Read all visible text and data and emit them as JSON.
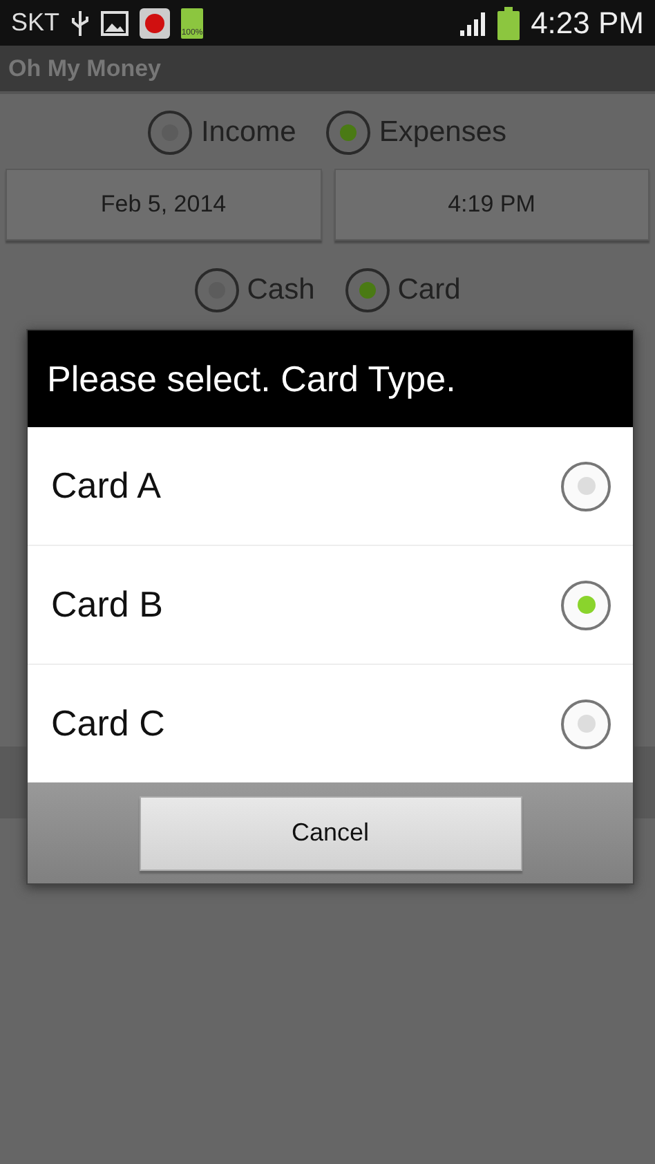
{
  "status_bar": {
    "carrier": "SKT",
    "battery_label": "100%",
    "time": "4:23 PM"
  },
  "app_bar": {
    "title": "Oh My Money"
  },
  "type_options": [
    {
      "label": "Income",
      "selected": false
    },
    {
      "label": "Expenses",
      "selected": true
    }
  ],
  "date_button": "Feb 5, 2014",
  "time_button": "4:19 PM",
  "payment_options": [
    {
      "label": "Cash",
      "selected": false
    },
    {
      "label": "Card",
      "selected": true
    }
  ],
  "dialog": {
    "title": "Please select. Card Type.",
    "options": [
      {
        "label": "Card A",
        "selected": false
      },
      {
        "label": "Card B",
        "selected": true
      },
      {
        "label": "Card C",
        "selected": false
      }
    ],
    "buttons": [
      "Cancel"
    ]
  }
}
